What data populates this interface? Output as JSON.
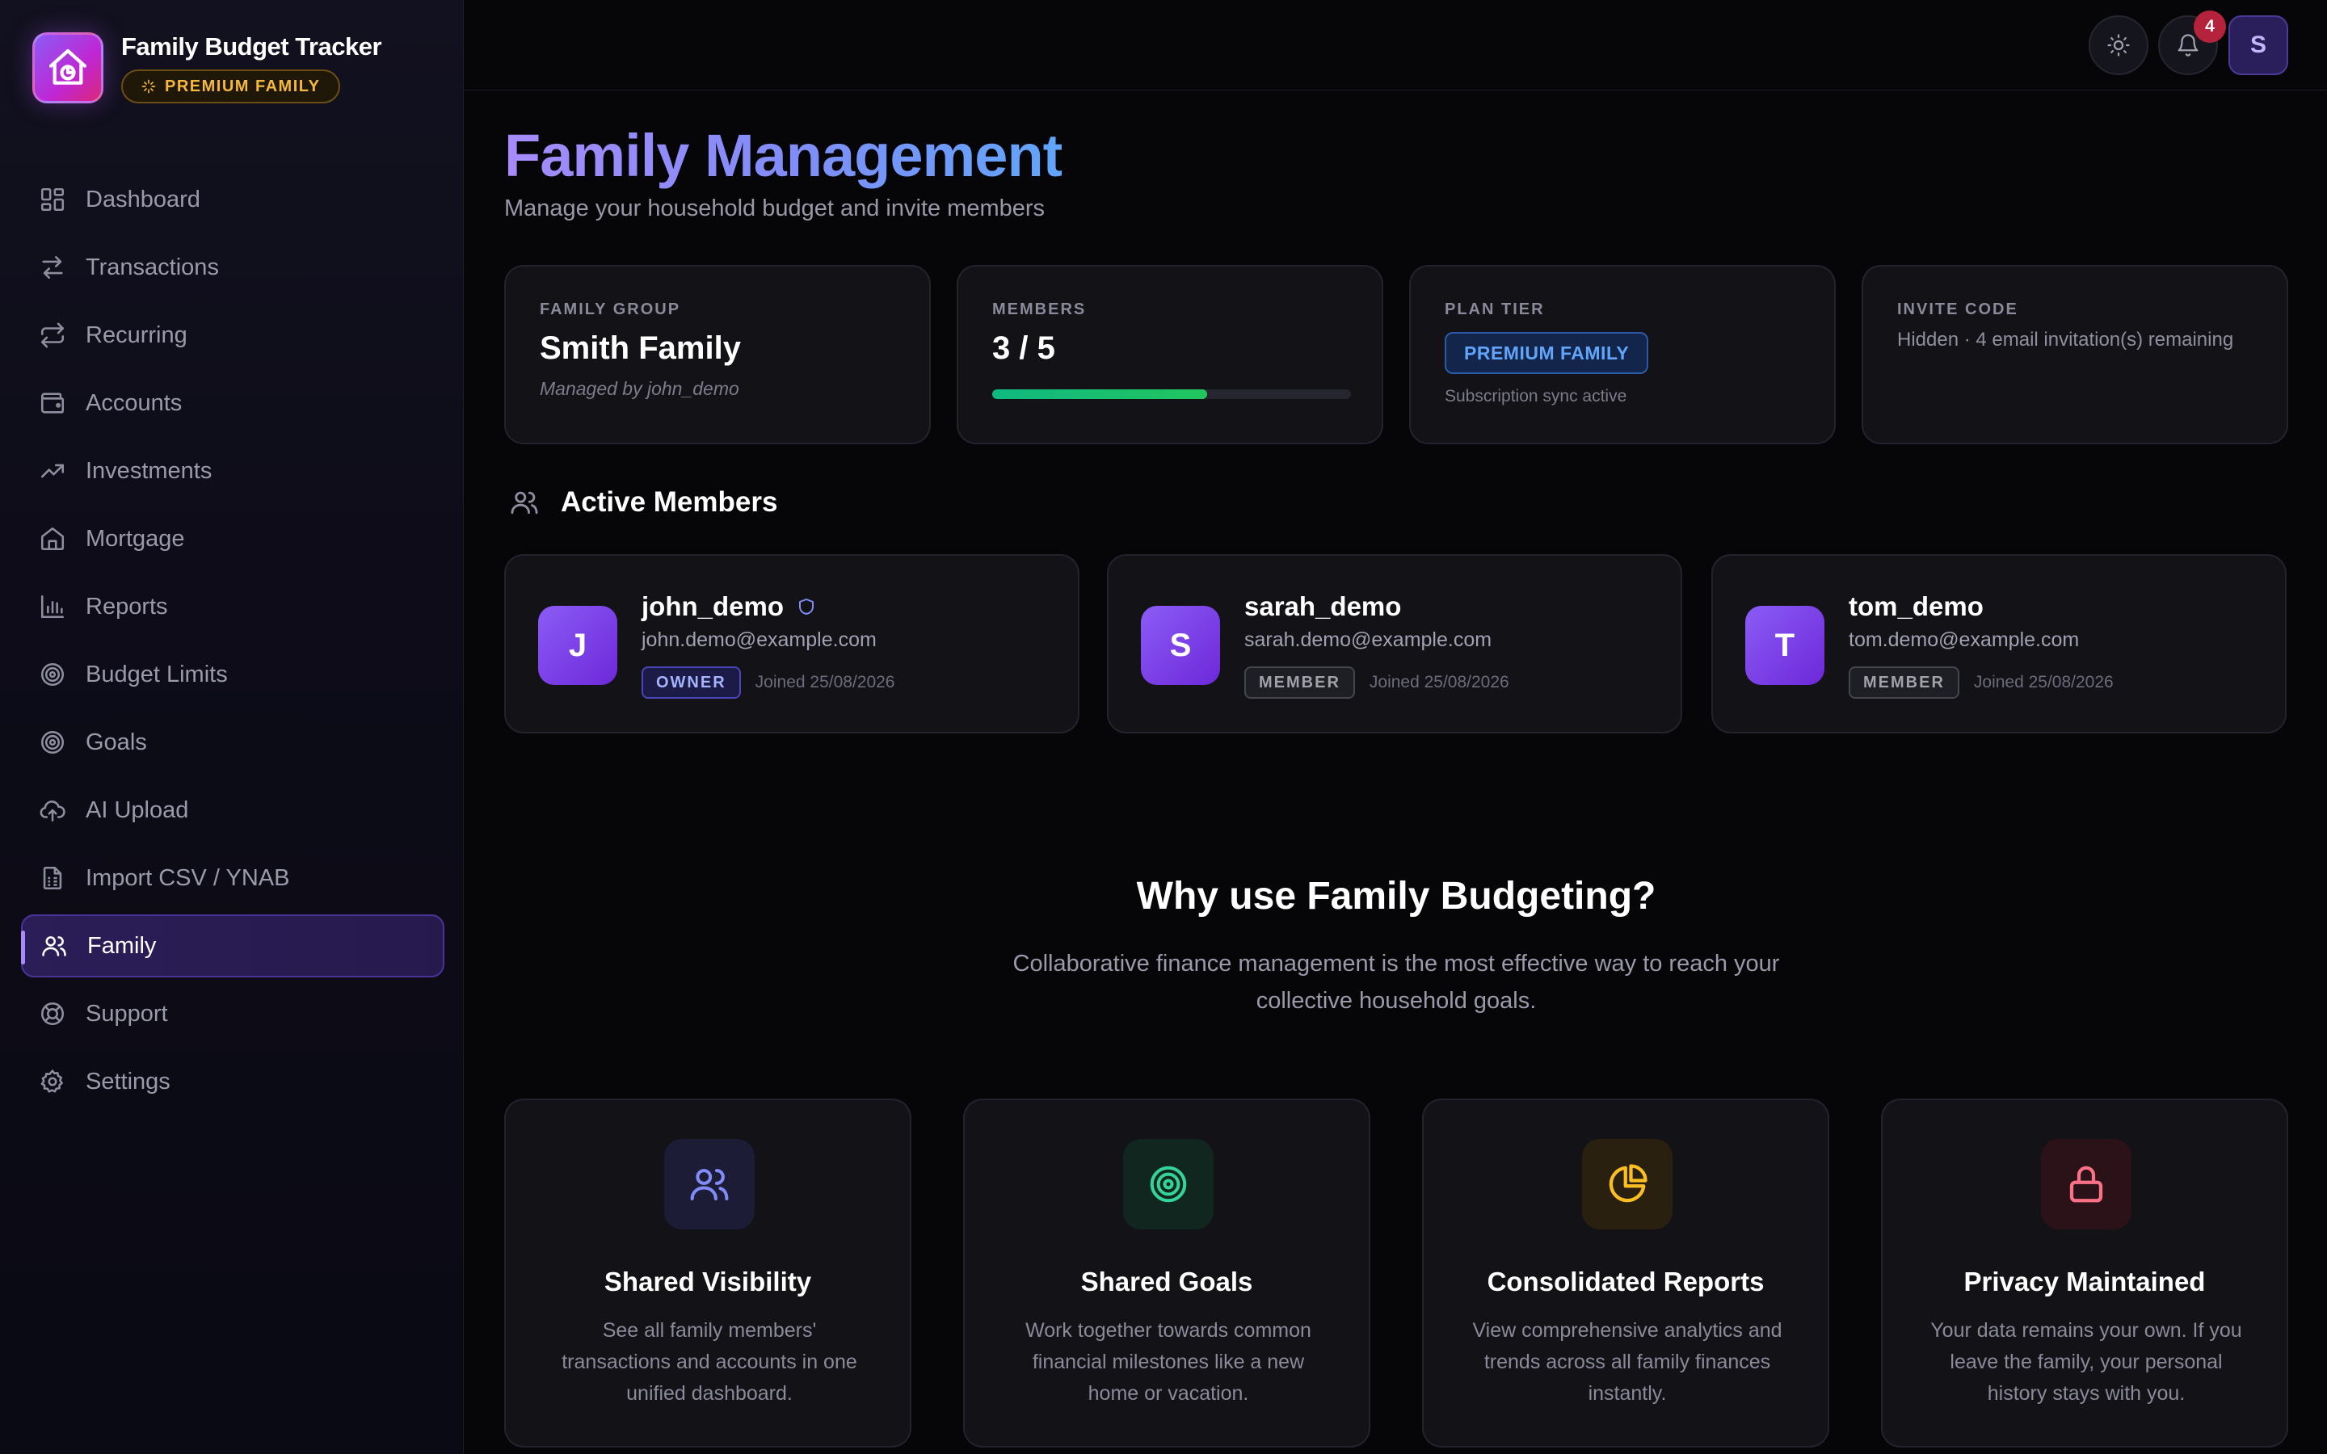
{
  "app": {
    "title": "Family Budget Tracker",
    "plan_badge": "PREMIUM FAMILY"
  },
  "sidebar": {
    "items": [
      {
        "label": "Dashboard",
        "icon": "dashboard-icon"
      },
      {
        "label": "Transactions",
        "icon": "transactions-icon"
      },
      {
        "label": "Recurring",
        "icon": "recurring-icon"
      },
      {
        "label": "Accounts",
        "icon": "wallet-icon"
      },
      {
        "label": "Investments",
        "icon": "trending-up-icon"
      },
      {
        "label": "Mortgage",
        "icon": "home-icon"
      },
      {
        "label": "Reports",
        "icon": "bar-chart-icon"
      },
      {
        "label": "Budget Limits",
        "icon": "target-icon"
      },
      {
        "label": "Goals",
        "icon": "target-icon"
      },
      {
        "label": "AI Upload",
        "icon": "cloud-upload-icon"
      },
      {
        "label": "Import CSV / YNAB",
        "icon": "spreadsheet-icon"
      },
      {
        "label": "Family",
        "icon": "users-icon",
        "active": true
      },
      {
        "label": "Support",
        "icon": "life-buoy-icon"
      },
      {
        "label": "Settings",
        "icon": "gear-icon"
      }
    ]
  },
  "topbar": {
    "notifications_count": "4",
    "user_initial": "S"
  },
  "page": {
    "title": "Family Management",
    "subtitle": "Manage your household budget and invite members"
  },
  "stats": {
    "family_group": {
      "label": "FAMILY GROUP",
      "value": "Smith Family",
      "note": "Managed by john_demo"
    },
    "members": {
      "label": "MEMBERS",
      "value": "3 / 5",
      "progress": 0.6
    },
    "plan_tier": {
      "label": "PLAN TIER",
      "value": "PREMIUM FAMILY",
      "note": "Subscription sync active"
    },
    "invite_code": {
      "label": "INVITE CODE",
      "note": "Hidden · 4 email invitation(s) remaining"
    }
  },
  "members_section": {
    "title": "Active Members",
    "members": [
      {
        "initial": "J",
        "name": "john_demo",
        "email": "john.demo@example.com",
        "role": "OWNER",
        "joined": "Joined 25/08/2026"
      },
      {
        "initial": "S",
        "name": "sarah_demo",
        "email": "sarah.demo@example.com",
        "role": "MEMBER",
        "joined": "Joined 25/08/2026"
      },
      {
        "initial": "T",
        "name": "tom_demo",
        "email": "tom.demo@example.com",
        "role": "MEMBER",
        "joined": "Joined 25/08/2026"
      }
    ]
  },
  "why": {
    "title": "Why use Family Budgeting?",
    "subtitle": "Collaborative finance management is the most effective way to reach your collective household goals.",
    "features": [
      {
        "title": "Shared Visibility",
        "desc": "See all family members' transactions and accounts in one unified dashboard.",
        "icon": "users-icon",
        "color": "#818cf8"
      },
      {
        "title": "Shared Goals",
        "desc": "Work together towards common financial milestones like a new home or vacation.",
        "icon": "target-icon",
        "color": "#34d399"
      },
      {
        "title": "Consolidated Reports",
        "desc": "View comprehensive analytics and trends across all family finances instantly.",
        "icon": "pie-chart-icon",
        "color": "#fbbf24"
      },
      {
        "title": "Privacy Maintained",
        "desc": "Your data remains your own. If you leave the family, your personal history stays with you.",
        "icon": "lock-icon",
        "color": "#fb7185"
      }
    ]
  }
}
